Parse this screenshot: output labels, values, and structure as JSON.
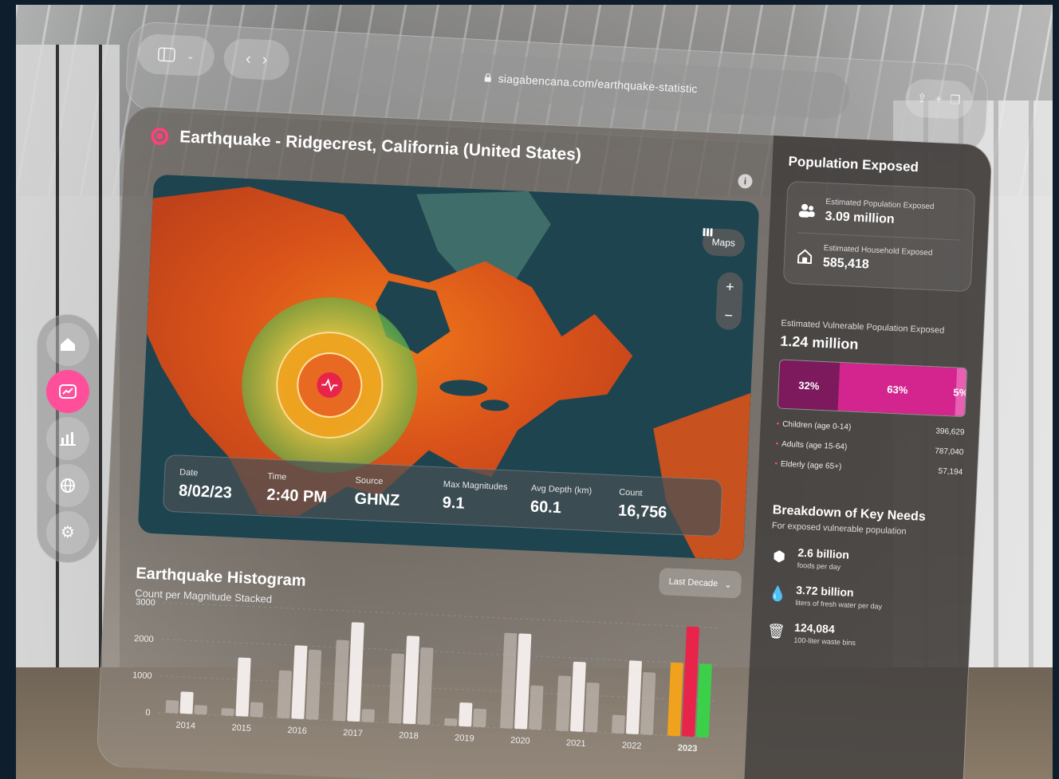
{
  "browser": {
    "url": "siagabencana.com/earthquake-statistic",
    "sidebar_icon": "sidebar-icon",
    "back_icon": "chevron-left-icon",
    "forward_icon": "chevron-right-icon"
  },
  "header": {
    "title": "Earthquake - Ridgecrest, California (United States)"
  },
  "map": {
    "maps_label": "Maps",
    "zoom_in": "+",
    "zoom_out": "−",
    "stats": [
      {
        "label": "Date",
        "value": "8/02/23"
      },
      {
        "label": "Time",
        "value": "2:40 PM"
      },
      {
        "label": "Source",
        "value": "GHNZ"
      },
      {
        "label": "Max Magnitudes",
        "value": "9.1"
      },
      {
        "label": "Avg Depth (km)",
        "value": "60.1"
      },
      {
        "label": "Count",
        "value": "16,756"
      }
    ]
  },
  "histogram": {
    "title": "Earthquake Histogram",
    "subtitle": "Count per Magnitude Stacked",
    "range_select": "Last Decade"
  },
  "chart_data": {
    "type": "bar",
    "title": "Earthquake Histogram",
    "subtitle": "Count per Magnitude Stacked",
    "categories": [
      "2014",
      "2015",
      "2016",
      "2017",
      "2018",
      "2019",
      "2020",
      "2021",
      "2022",
      "2023"
    ],
    "series": [
      {
        "values": [
          350,
          200,
          1300,
          2200,
          1900,
          200,
          2600,
          1500,
          500,
          2000
        ]
      },
      {
        "values": [
          600,
          1600,
          2000,
          2700,
          2400,
          650,
          2600,
          1900,
          2000,
          3000
        ]
      },
      {
        "values": [
          250,
          400,
          1900,
          350,
          2100,
          500,
          1200,
          1350,
          1700,
          2000
        ]
      }
    ],
    "yticks": [
      "0",
      "1000",
      "2000",
      "3000"
    ],
    "ylim": [
      0,
      3000
    ],
    "grid": true
  },
  "population": {
    "title": "Population Exposed",
    "estimated_population_label": "Estimated Population Exposed",
    "estimated_population_value": "3.09 million",
    "estimated_household_label": "Estimated Household Exposed",
    "estimated_household_value": "585,418",
    "vulnerable_label": "Estimated Vulnerable Population Exposed",
    "vulnerable_value": "1.24 million",
    "segments": [
      {
        "label": "32%",
        "fraction": 0.32,
        "color": "#7d1a5e"
      },
      {
        "label": "63%",
        "fraction": 0.63,
        "color": "#d4248e"
      },
      {
        "label": "5%",
        "fraction": 0.05,
        "color": "#e85fb4"
      }
    ],
    "groups": [
      {
        "name": "Children (age 0-14)",
        "value": "396,629"
      },
      {
        "name": "Adults (age 15-64)",
        "value": "787,040"
      },
      {
        "name": "Elderly (age 65+)",
        "value": "57,194"
      }
    ]
  },
  "needs": {
    "title": "Breakdown of Key Needs",
    "subtitle": "For exposed vulnerable population",
    "items": [
      {
        "value": "2.6 billion",
        "unit": "foods per day",
        "icon": "box-icon"
      },
      {
        "value": "3.72 billion",
        "unit": "liters of fresh water per day",
        "icon": "water-drop-icon"
      },
      {
        "value": "124,084",
        "unit": "100-liter waste bins",
        "icon": "trash-bin-icon"
      }
    ]
  },
  "colors": {
    "accent": "#ff4f9a",
    "epicenter": "#e8244a",
    "panel": "#6e6964"
  }
}
